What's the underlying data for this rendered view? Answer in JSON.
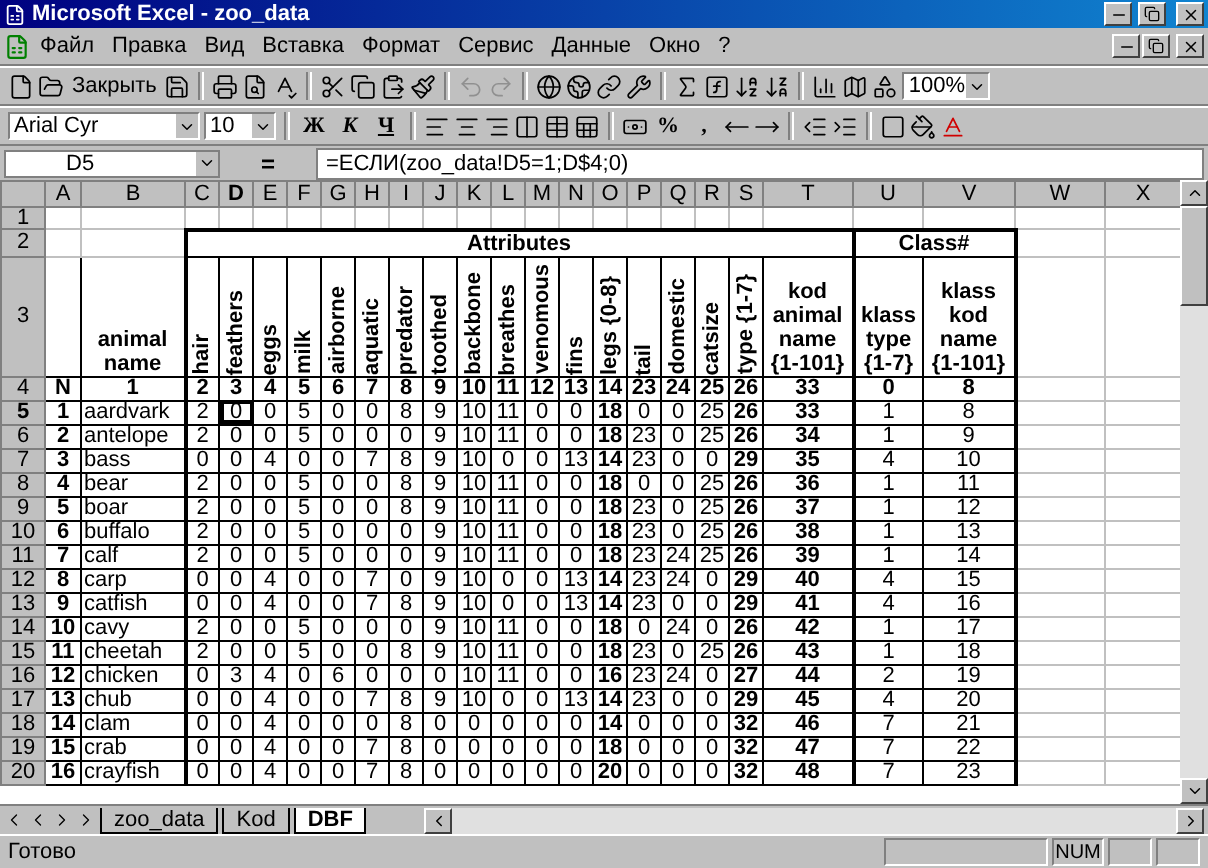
{
  "window": {
    "title": "Microsoft Excel - zoo_data"
  },
  "menu": [
    "Файл",
    "Правка",
    "Вид",
    "Вставка",
    "Формат",
    "Сервис",
    "Данные",
    "Окно",
    "?"
  ],
  "toolbar": {
    "close_label": "Закрыть",
    "zoom": "100%"
  },
  "format_toolbar": {
    "font": "Arial Cyr",
    "size": "10",
    "style_buttons": [
      "Ж",
      "К",
      "Ч"
    ],
    "number_buttons": [
      "%",
      ","
    ]
  },
  "formula_bar": {
    "name_box": "D5",
    "equals": "=",
    "formula": "=ЕСЛИ(zoo_data!D5=1;D$4;0)"
  },
  "sheet": {
    "columns": [
      {
        "label": "A",
        "selected": false
      },
      {
        "label": "B",
        "selected": false
      },
      {
        "label": "C",
        "selected": false
      },
      {
        "label": "D",
        "selected": true
      },
      {
        "label": "E",
        "selected": false
      },
      {
        "label": "F",
        "selected": false
      },
      {
        "label": "G",
        "selected": false
      },
      {
        "label": "H",
        "selected": false
      },
      {
        "label": "I",
        "selected": false
      },
      {
        "label": "J",
        "selected": false
      },
      {
        "label": "K",
        "selected": false
      },
      {
        "label": "L",
        "selected": false
      },
      {
        "label": "M",
        "selected": false
      },
      {
        "label": "N",
        "selected": false
      },
      {
        "label": "O",
        "selected": false
      },
      {
        "label": "P",
        "selected": false
      },
      {
        "label": "Q",
        "selected": false
      },
      {
        "label": "R",
        "selected": false
      },
      {
        "label": "S",
        "selected": false
      },
      {
        "label": "T",
        "selected": false
      },
      {
        "label": "U",
        "selected": false
      },
      {
        "label": "V",
        "selected": false
      },
      {
        "label": "W",
        "selected": false
      },
      {
        "label": "X",
        "selected": false
      }
    ],
    "rows": [
      {
        "number": "1",
        "selected": false,
        "kind": "blank"
      },
      {
        "number": "2",
        "selected": false,
        "kind": "group",
        "groups": [
          "Attributes",
          "Class#"
        ]
      },
      {
        "number": "3",
        "selected": false,
        "kind": "header",
        "cells": [
          "animal name",
          "hair",
          "feathers",
          "eggs",
          "milk",
          "airborne",
          "aquatic",
          "predator",
          "toothed",
          "backbone",
          "breathes",
          "venomous",
          "fins",
          "legs {0-8}",
          "tail",
          "domestic",
          "catsize",
          "type {1-7}",
          "kod animal name {1-101}",
          "klass type {1-7}",
          "klass kod name {1-101}"
        ]
      },
      {
        "number": "4",
        "selected": false,
        "kind": "index",
        "cells": [
          "N",
          "1",
          "2",
          "3",
          "4",
          "5",
          "6",
          "7",
          "8",
          "9",
          "10",
          "11",
          "12",
          "13",
          "14",
          "23",
          "24",
          "25",
          "26",
          "33",
          "0",
          "8"
        ]
      },
      {
        "number": "5",
        "selected": true,
        "kind": "data",
        "cells": [
          "1",
          "aardvark",
          "2",
          "0",
          "0",
          "5",
          "0",
          "0",
          "8",
          "9",
          "10",
          "11",
          "0",
          "0",
          "18",
          "0",
          "0",
          "25",
          "26",
          "33",
          "1",
          "8"
        ]
      },
      {
        "number": "6",
        "selected": false,
        "kind": "data",
        "cells": [
          "2",
          "antelope",
          "2",
          "0",
          "0",
          "5",
          "0",
          "0",
          "0",
          "9",
          "10",
          "11",
          "0",
          "0",
          "18",
          "23",
          "0",
          "25",
          "26",
          "34",
          "1",
          "9"
        ]
      },
      {
        "number": "7",
        "selected": false,
        "kind": "data",
        "cells": [
          "3",
          "bass",
          "0",
          "0",
          "4",
          "0",
          "0",
          "7",
          "8",
          "9",
          "10",
          "0",
          "0",
          "13",
          "14",
          "23",
          "0",
          "0",
          "29",
          "35",
          "4",
          "10"
        ]
      },
      {
        "number": "8",
        "selected": false,
        "kind": "data",
        "cells": [
          "4",
          "bear",
          "2",
          "0",
          "0",
          "5",
          "0",
          "0",
          "8",
          "9",
          "10",
          "11",
          "0",
          "0",
          "18",
          "0",
          "0",
          "25",
          "26",
          "36",
          "1",
          "11"
        ]
      },
      {
        "number": "9",
        "selected": false,
        "kind": "data",
        "cells": [
          "5",
          "boar",
          "2",
          "0",
          "0",
          "5",
          "0",
          "0",
          "8",
          "9",
          "10",
          "11",
          "0",
          "0",
          "18",
          "23",
          "0",
          "25",
          "26",
          "37",
          "1",
          "12"
        ]
      },
      {
        "number": "10",
        "selected": false,
        "kind": "data",
        "cells": [
          "6",
          "buffalo",
          "2",
          "0",
          "0",
          "5",
          "0",
          "0",
          "0",
          "9",
          "10",
          "11",
          "0",
          "0",
          "18",
          "23",
          "0",
          "25",
          "26",
          "38",
          "1",
          "13"
        ]
      },
      {
        "number": "11",
        "selected": false,
        "kind": "data",
        "cells": [
          "7",
          "calf",
          "2",
          "0",
          "0",
          "5",
          "0",
          "0",
          "0",
          "9",
          "10",
          "11",
          "0",
          "0",
          "18",
          "23",
          "24",
          "25",
          "26",
          "39",
          "1",
          "14"
        ]
      },
      {
        "number": "12",
        "selected": false,
        "kind": "data",
        "cells": [
          "8",
          "carp",
          "0",
          "0",
          "4",
          "0",
          "0",
          "7",
          "0",
          "9",
          "10",
          "0",
          "0",
          "13",
          "14",
          "23",
          "24",
          "0",
          "29",
          "40",
          "4",
          "15"
        ]
      },
      {
        "number": "13",
        "selected": false,
        "kind": "data",
        "cells": [
          "9",
          "catfish",
          "0",
          "0",
          "4",
          "0",
          "0",
          "7",
          "8",
          "9",
          "10",
          "0",
          "0",
          "13",
          "14",
          "23",
          "0",
          "0",
          "29",
          "41",
          "4",
          "16"
        ]
      },
      {
        "number": "14",
        "selected": false,
        "kind": "data",
        "cells": [
          "10",
          "cavy",
          "2",
          "0",
          "0",
          "5",
          "0",
          "0",
          "0",
          "9",
          "10",
          "11",
          "0",
          "0",
          "18",
          "0",
          "24",
          "0",
          "26",
          "42",
          "1",
          "17"
        ]
      },
      {
        "number": "15",
        "selected": false,
        "kind": "data",
        "cells": [
          "11",
          "cheetah",
          "2",
          "0",
          "0",
          "5",
          "0",
          "0",
          "8",
          "9",
          "10",
          "11",
          "0",
          "0",
          "18",
          "23",
          "0",
          "25",
          "26",
          "43",
          "1",
          "18"
        ]
      },
      {
        "number": "16",
        "selected": false,
        "kind": "data",
        "cells": [
          "12",
          "chicken",
          "0",
          "3",
          "4",
          "0",
          "6",
          "0",
          "0",
          "0",
          "10",
          "11",
          "0",
          "0",
          "16",
          "23",
          "24",
          "0",
          "27",
          "44",
          "2",
          "19"
        ]
      },
      {
        "number": "17",
        "selected": false,
        "kind": "data",
        "cells": [
          "13",
          "chub",
          "0",
          "0",
          "4",
          "0",
          "0",
          "7",
          "8",
          "9",
          "10",
          "0",
          "0",
          "13",
          "14",
          "23",
          "0",
          "0",
          "29",
          "45",
          "4",
          "20"
        ]
      },
      {
        "number": "18",
        "selected": false,
        "kind": "data",
        "cells": [
          "14",
          "clam",
          "0",
          "0",
          "4",
          "0",
          "0",
          "0",
          "8",
          "0",
          "0",
          "0",
          "0",
          "0",
          "14",
          "0",
          "0",
          "0",
          "32",
          "46",
          "7",
          "21"
        ]
      },
      {
        "number": "19",
        "selected": false,
        "kind": "data",
        "cells": [
          "15",
          "crab",
          "0",
          "0",
          "4",
          "0",
          "0",
          "7",
          "8",
          "0",
          "0",
          "0",
          "0",
          "0",
          "18",
          "0",
          "0",
          "0",
          "32",
          "47",
          "7",
          "22"
        ]
      },
      {
        "number": "20",
        "selected": false,
        "kind": "data",
        "cells": [
          "16",
          "crayfish",
          "0",
          "0",
          "4",
          "0",
          "0",
          "7",
          "8",
          "0",
          "0",
          "0",
          "0",
          "0",
          "20",
          "0",
          "0",
          "0",
          "32",
          "48",
          "7",
          "23"
        ]
      }
    ]
  },
  "sheet_tabs": [
    {
      "label": "zoo_data",
      "selected": false
    },
    {
      "label": "Kod",
      "selected": false
    },
    {
      "label": "DBF",
      "selected": true
    }
  ],
  "status_bar": {
    "text": "Готово",
    "indicators": [
      "NUM"
    ]
  }
}
